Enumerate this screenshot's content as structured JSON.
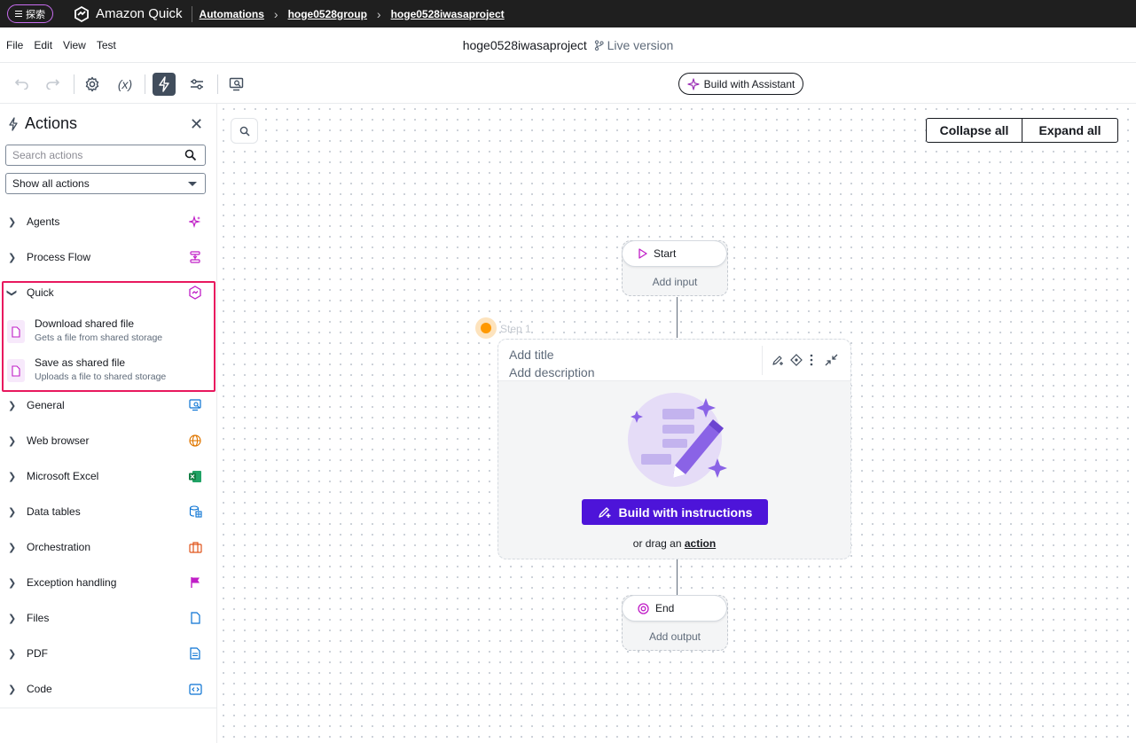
{
  "topbar": {
    "explore_label": "探索",
    "app_name": "Amazon Quick",
    "breadcrumbs": [
      "Automations",
      "hoge0528group",
      "hoge0528iwasaproject"
    ]
  },
  "menu": {
    "items": [
      "File",
      "Edit",
      "View",
      "Test"
    ],
    "project_name": "hoge0528iwasaproject",
    "version_label": "Live version"
  },
  "toolbar": {
    "build_assistant_label": "Build with Assistant"
  },
  "panel": {
    "title": "Actions",
    "search_placeholder": "Search actions",
    "filter_value": "Show all actions",
    "categories": [
      {
        "label": "Agents",
        "icon": "sparkle-icon",
        "expanded": false
      },
      {
        "label": "Process Flow",
        "icon": "process-flow-icon",
        "expanded": false
      },
      {
        "label": "Quick",
        "icon": "quick-icon",
        "expanded": true
      },
      {
        "label": "General",
        "icon": "monitor-search-icon",
        "expanded": false
      },
      {
        "label": "Web browser",
        "icon": "globe-icon",
        "expanded": false
      },
      {
        "label": "Microsoft Excel",
        "icon": "excel-icon",
        "expanded": false
      },
      {
        "label": "Data tables",
        "icon": "data-table-icon",
        "expanded": false
      },
      {
        "label": "Orchestration",
        "icon": "briefcase-icon",
        "expanded": false
      },
      {
        "label": "Exception handling",
        "icon": "flag-icon",
        "expanded": false
      },
      {
        "label": "Files",
        "icon": "file-icon",
        "expanded": false
      },
      {
        "label": "PDF",
        "icon": "pdf-icon",
        "expanded": false
      },
      {
        "label": "Code",
        "icon": "code-icon",
        "expanded": false
      }
    ],
    "quick_items": [
      {
        "title": "Download shared file",
        "desc": "Gets a file from shared storage"
      },
      {
        "title": "Save as shared file",
        "desc": "Uploads a file to shared storage"
      }
    ]
  },
  "canvas": {
    "collapse_all": "Collapse all",
    "expand_all": "Expand all",
    "start": {
      "label": "Start",
      "sub": "Add input"
    },
    "step": {
      "label": "Step 1",
      "title_placeholder": "Add title",
      "desc_placeholder": "Add description",
      "build_label": "Build with instructions",
      "drag_prefix": "or drag an",
      "drag_link": "action"
    },
    "end": {
      "label": "End",
      "sub": "Add output"
    }
  },
  "colors": {
    "accent_purple": "#4d14d9",
    "highlight_pink": "#e8185e",
    "step_dot": "#ff9900",
    "topbar_bg": "#1f1f1f"
  }
}
